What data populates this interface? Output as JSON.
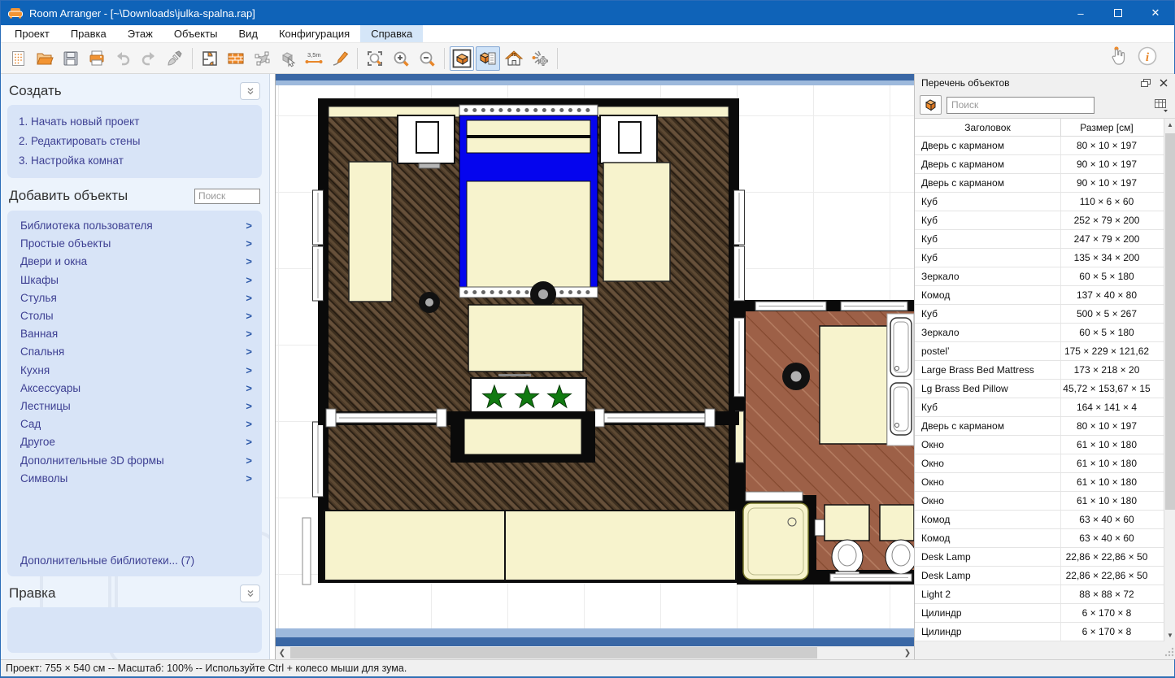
{
  "window": {
    "title": "Room Arranger - [~\\Downloads\\julka-spalna.rap]",
    "controls": {
      "minimize": "–",
      "maximize": "",
      "close": "✕"
    }
  },
  "menu": {
    "items": [
      "Проект",
      "Правка",
      "Этаж",
      "Объекты",
      "Вид",
      "Конфигурация",
      "Справка"
    ],
    "active": "Справка"
  },
  "toolbar": {
    "measure_label": "3,5m",
    "icons": [
      "new-project",
      "open",
      "save",
      "print",
      "undo",
      "redo",
      "format-brush",
      "edit-walls",
      "wall",
      "edit-points",
      "add-object",
      "measure",
      "draw",
      "zoom-fit",
      "zoom-in",
      "zoom-out",
      "view-3d",
      "view-3d-list",
      "home-3d",
      "walkthrough",
      "hand-pointer",
      "about-info"
    ],
    "selected": [
      "view-3d",
      "view-3d-list"
    ]
  },
  "sidebar": {
    "create": {
      "title": "Создать",
      "steps": [
        "1. Начать новый проект",
        "2. Редактировать стены",
        "3. Настройка комнат"
      ]
    },
    "add_objects": {
      "title": "Добавить объекты",
      "search_placeholder": "Поиск",
      "categories": [
        "Библиотека пользователя",
        "Простые объекты",
        "Двери и окна",
        "Шкафы",
        "Стулья",
        "Столы",
        "Ванная",
        "Спальня",
        "Кухня",
        "Аксессуары",
        "Лестницы",
        "Сад",
        "Другое",
        "Дополнительные 3D формы",
        "Символы"
      ],
      "more_libraries": "Дополнительные библиотеки... (7)"
    },
    "edit": {
      "title": "Правка"
    }
  },
  "object_list": {
    "title": "Перечень объектов",
    "search_placeholder": "Поиск",
    "columns": [
      "Заголовок",
      "Размер [см]"
    ],
    "rows": [
      [
        "Дверь с карманом",
        "80 × 10 × 197"
      ],
      [
        "Дверь с карманом",
        "90 × 10 × 197"
      ],
      [
        "Дверь с карманом",
        "90 × 10 × 197"
      ],
      [
        "Куб",
        "110 × 6 × 60"
      ],
      [
        "Куб",
        "252 × 79 × 200"
      ],
      [
        "Куб",
        "247 × 79 × 200"
      ],
      [
        "Куб",
        "135 × 34 × 200"
      ],
      [
        "Зеркало",
        "60 × 5 × 180"
      ],
      [
        "Комод",
        "137 × 40 × 80"
      ],
      [
        "Куб",
        "500 × 5 × 267"
      ],
      [
        "Зеркало",
        "60 × 5 × 180"
      ],
      [
        "postelʼ",
        "175 × 229 × 121,62"
      ],
      [
        "Large Brass Bed Mattress",
        "173 × 218 × 20"
      ],
      [
        "Lg Brass Bed Pillow",
        "45,72 × 153,67 × 15"
      ],
      [
        "Куб",
        "164 × 141 × 4"
      ],
      [
        "Дверь с карманом",
        "80 × 10 × 197"
      ],
      [
        "Окно",
        "61 × 10 × 180"
      ],
      [
        "Окно",
        "61 × 10 × 180"
      ],
      [
        "Окно",
        "61 × 10 × 180"
      ],
      [
        "Окно",
        "61 × 10 × 180"
      ],
      [
        "Комод",
        "63 × 40 × 60"
      ],
      [
        "Комод",
        "63 × 40 × 60"
      ],
      [
        "Desk Lamp",
        "22,86 × 22,86 × 50"
      ],
      [
        "Desk Lamp",
        "22,86 × 22,86 × 50"
      ],
      [
        "Light 2",
        "88 × 88 × 72"
      ],
      [
        "Цилиндр",
        "6 × 170 × 8"
      ],
      [
        "Цилиндр",
        "6 × 170 × 8"
      ]
    ]
  },
  "statusbar": {
    "text": "Проект: 755 × 540 см -- Масштаб: 100% -- Используйте Ctrl + колесо мыши для зума."
  },
  "colors": {
    "titlebar": "#0f63b8",
    "accent_orange": "#ef8b2c",
    "bed_blue": "#0505ee",
    "furniture_cream": "#f7f3cd",
    "selection_blue": "#cfe3f8",
    "wood_floor": "#4c3a27",
    "bathroom_tile": "#9d6047"
  }
}
